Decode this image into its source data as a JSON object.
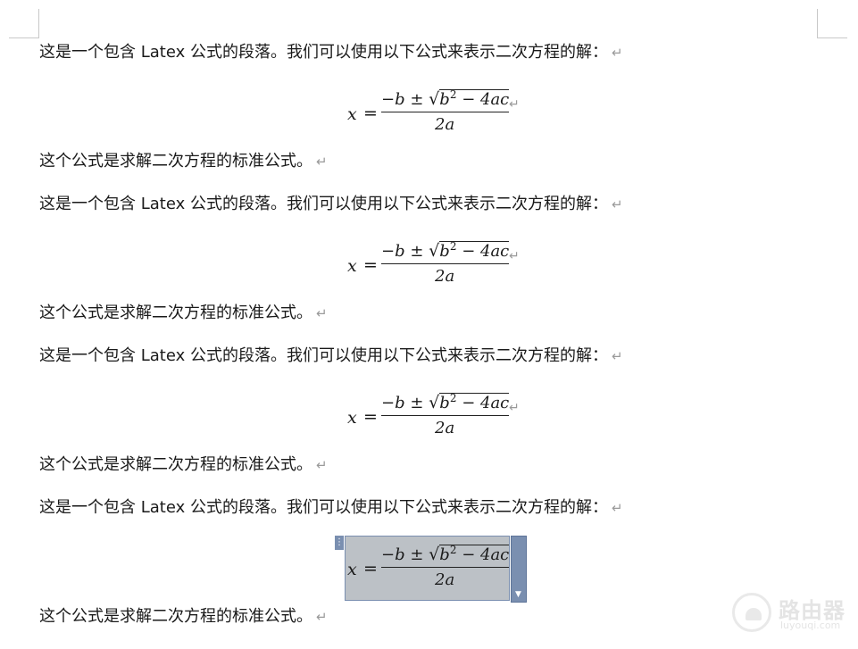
{
  "doc": {
    "paragraphs": [
      "这是一个包含 Latex 公式的段落。我们可以使用以下公式来表示二次方程的解：",
      "这个公式是求解二次方程的标准公式。"
    ],
    "paragraph_mark": "↵"
  },
  "equation": {
    "x": "x",
    "equals": "=",
    "minus_b": "−b",
    "plus_minus": "±",
    "sqrt": "√",
    "b_squared": "b",
    "exp": "2",
    "minus_4ac": "− 4ac",
    "denominator": "2a"
  },
  "watermark": {
    "text": "路由器",
    "sub": "luyouqi.com"
  },
  "colors": {
    "selection_bg": "#bcc1c6",
    "selection_border": "#7a8fb0"
  }
}
